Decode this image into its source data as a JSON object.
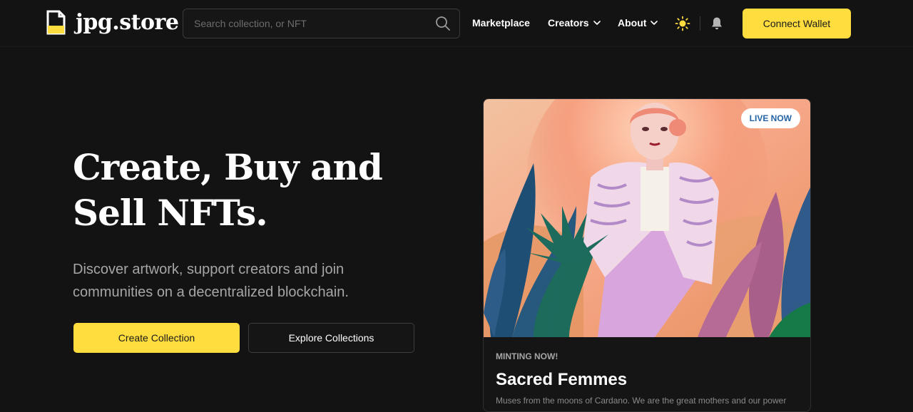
{
  "brand": {
    "name": "jpg.store",
    "accent": "#ffdd3e"
  },
  "search": {
    "placeholder": "Search collection, or NFT"
  },
  "nav": {
    "marketplace": "Marketplace",
    "creators": "Creators",
    "about": "About"
  },
  "header": {
    "connect_wallet": "Connect Wallet"
  },
  "hero": {
    "title_line1": "Create, Buy and",
    "title_line2": "Sell NFTs.",
    "subtitle_line1": "Discover artwork, support creators and join",
    "subtitle_line2": "communities on a decentralized blockchain.",
    "create_button": "Create Collection",
    "explore_button": "Explore Collections"
  },
  "featured": {
    "badge": "LIVE NOW",
    "label": "MINTING NOW!",
    "title": "Sacred Femmes",
    "description": "Muses from the moons of Cardano. We are the great mothers and our power"
  },
  "icons": [
    "logo-icon",
    "search-icon",
    "chevron-down-icon",
    "sun-icon",
    "bell-icon"
  ]
}
